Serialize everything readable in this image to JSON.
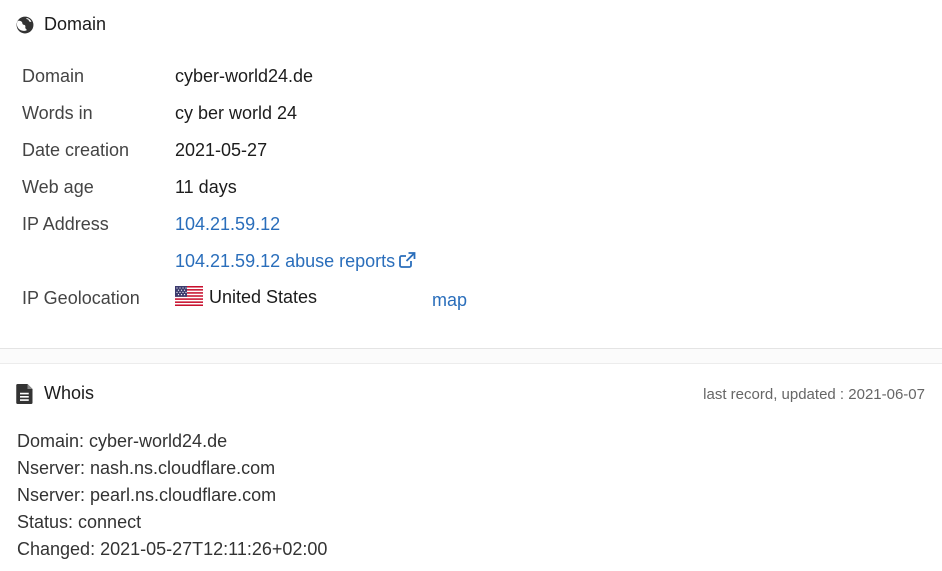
{
  "domain_section": {
    "title": "Domain",
    "rows": [
      {
        "label": "Domain",
        "value": "cyber-world24.de"
      },
      {
        "label": "Words in",
        "value": "cy ber world 24"
      },
      {
        "label": "Date creation",
        "value": "2021-05-27"
      },
      {
        "label": "Web age",
        "value": "11 days"
      },
      {
        "label": "IP Address",
        "value": "104.21.59.12"
      }
    ],
    "abuse_link": "104.21.59.12 abuse reports",
    "geolocation": {
      "label": "IP Geolocation",
      "country": "United States",
      "map_link": "map"
    }
  },
  "whois_section": {
    "title": "Whois",
    "updated": "last record, updated : 2021-06-07",
    "lines": [
      "Domain: cyber-world24.de",
      "Nserver: nash.ns.cloudflare.com",
      "Nserver: pearl.ns.cloudflare.com",
      "Status: connect",
      "Changed: 2021-05-27T12:11:26+02:00"
    ]
  },
  "icons": {
    "domain": "globe-icon",
    "whois": "document-icon",
    "external": "external-link-icon",
    "flag": "us-flag-icon"
  }
}
